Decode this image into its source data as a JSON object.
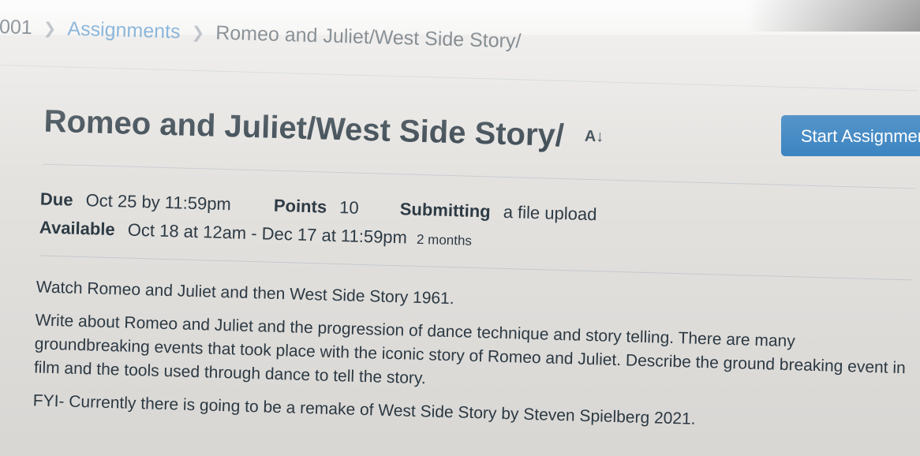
{
  "breadcrumb": {
    "course": "001",
    "assignments": "Assignments",
    "current": "Romeo and Juliet/West Side Story/"
  },
  "assignment": {
    "title": "Romeo and Juliet/West Side Story/",
    "start_button": "Start Assignment",
    "due_label": "Due",
    "due_value": "Oct 25 by 11:59pm",
    "points_label": "Points",
    "points_value": "10",
    "submitting_label": "Submitting",
    "submitting_value": "a file upload",
    "available_label": "Available",
    "available_value": "Oct 18 at 12am - Dec 17 at 11:59pm",
    "available_duration": "2 months"
  },
  "description": {
    "p1": "Watch Romeo and Juliet and then West Side Story 1961.",
    "p2": "Write about Romeo and Juliet and the progression of dance technique and story telling. There are many groundbreaking events that took place with the iconic story of Romeo and Juliet. Describe the ground breaking event in film and the tools used through dance to tell the story.",
    "p3": "FYI- Currently there is going to be a remake of West Side Story by Steven Spielberg 2021."
  },
  "icons": {
    "breadcrumb_separator": "chevron-right-icon",
    "accessibility": "a11y-checker-icon"
  },
  "colors": {
    "link": "#2b7abc",
    "button": "#2b7abc",
    "text": "#2d3b45"
  }
}
